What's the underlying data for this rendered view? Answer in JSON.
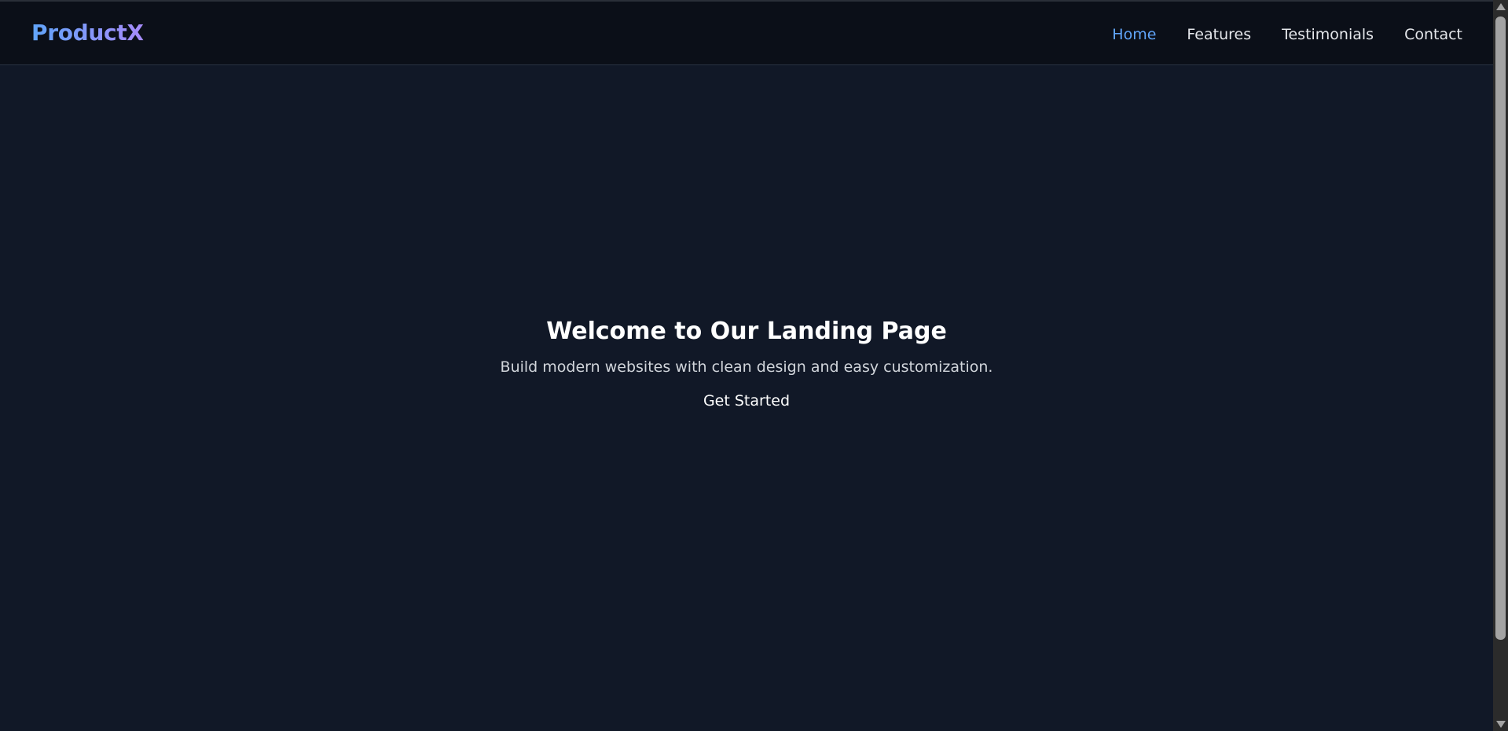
{
  "brand": {
    "name": "ProductX",
    "gradient_start": "#60a5fa",
    "gradient_end": "#a78bfa"
  },
  "nav": {
    "items": [
      {
        "label": "Home",
        "active": true
      },
      {
        "label": "Features",
        "active": false
      },
      {
        "label": "Testimonials",
        "active": false
      },
      {
        "label": "Contact",
        "active": false
      }
    ],
    "active_color": "#60a5fa"
  },
  "hero": {
    "title": "Welcome to Our Landing Page",
    "subtitle": "Build modern websites with clean design and easy customization.",
    "cta_label": "Get Started"
  },
  "colors": {
    "page_background": "#111827",
    "navbar_background": "#0b0f18",
    "text_primary": "#ffffff",
    "text_secondary": "#d1d5db"
  }
}
